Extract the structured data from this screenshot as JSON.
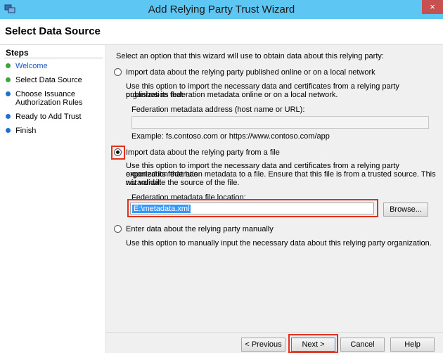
{
  "window": {
    "title": "Add Relying Party Trust Wizard",
    "close_glyph": "×"
  },
  "header": {
    "page_title": "Select Data Source"
  },
  "sidebar": {
    "title": "Steps",
    "items": [
      {
        "label": "Welcome",
        "status_color": "#3aa53a",
        "label_color": "#1a56c8"
      },
      {
        "label": "Select Data Source",
        "status_color": "#3aa53a",
        "label_color": "#000000"
      },
      {
        "label": "Choose Issuance",
        "label2": "Authorization Rules",
        "status_color": "#1f6fd4",
        "label_color": "#000000"
      },
      {
        "label": "Ready to Add Trust",
        "status_color": "#1f6fd4",
        "label_color": "#000000"
      },
      {
        "label": "Finish",
        "status_color": "#1f6fd4",
        "label_color": "#000000"
      }
    ]
  },
  "main": {
    "intro": "Select an option that this wizard will use to obtain data about this relying party:",
    "option_online": {
      "label": "Import data about the relying party published online or on a local network",
      "desc_line1": "Use this option to import the necessary data and certificates from a relying party organization that",
      "desc_line2": "publishes its federation metadata online or on a local network.",
      "address_label": "Federation metadata address (host name or URL):",
      "address_value": "",
      "example": "Example: fs.contoso.com or https://www.contoso.com/app"
    },
    "option_file": {
      "label": "Import data about the relying party from a file",
      "desc_line1": "Use this option to import the necessary data and certificates from a relying party organization that has",
      "desc_line2": "exported its federation metadata to a file. Ensure that this file is from a trusted source.  This wizard will",
      "desc_line3": "not validate the source of the file.",
      "file_label": "Federation metadata file location:",
      "file_value": "E:\\metadata.xml",
      "browse_label": "Browse..."
    },
    "option_manual": {
      "label": "Enter data about the relying party manually",
      "desc": "Use this option to manually input the necessary data about this relying party organization."
    },
    "selected_option": "file"
  },
  "footer": {
    "previous": "< Previous",
    "next": "Next >",
    "cancel": "Cancel",
    "help": "Help"
  },
  "highlight_color": "#e0301e"
}
